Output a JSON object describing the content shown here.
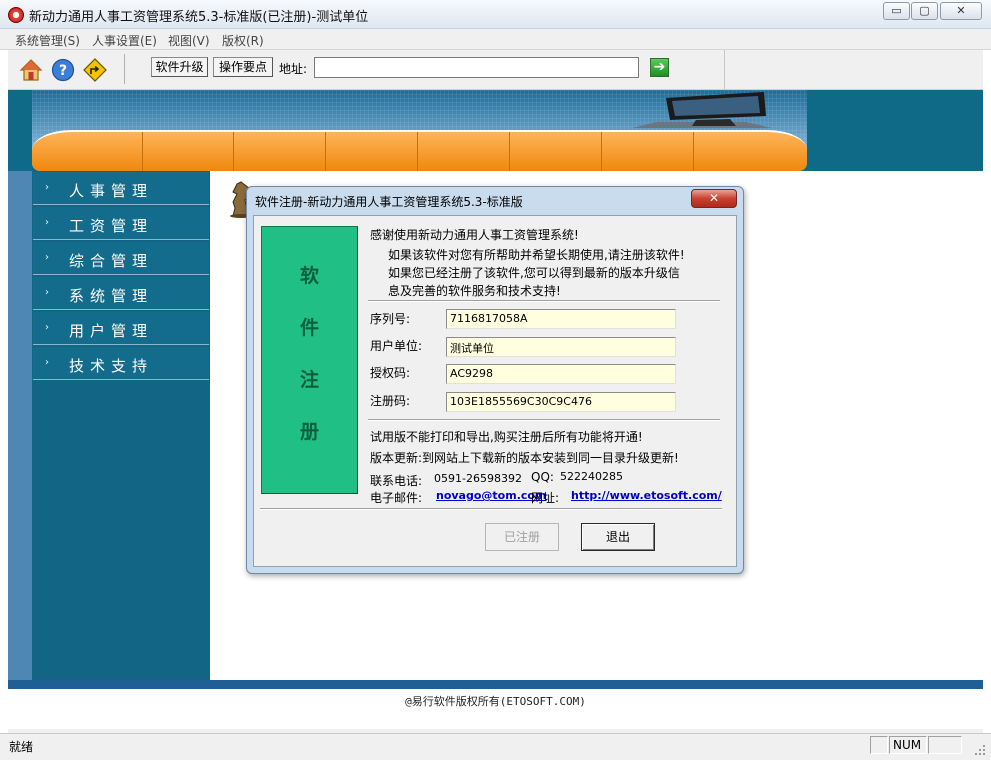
{
  "window": {
    "title": "新动力通用人事工资管理系统5.3-标准版(已注册)-测试单位",
    "minimize_glyph": "▭",
    "maximize_glyph": "▢",
    "close_glyph": "✕"
  },
  "menu": [
    "系统管理(S)",
    "人事设置(E)",
    "视图(V)",
    "版权(R)"
  ],
  "toolbar": {
    "upgrade_label": "软件升级",
    "tips_label": "操作要点",
    "address_label": "地址:",
    "address_value": "",
    "go_glyph": "➔"
  },
  "sidebar": {
    "items": [
      "人事管理",
      "工资管理",
      "综合管理",
      "系统管理",
      "用户管理",
      "技术支持"
    ]
  },
  "dialog": {
    "title": "软件注册-新动力通用人事工资管理系统5.3-标准版",
    "close_glyph": "✕",
    "panel_chars": [
      "软",
      "件",
      "注",
      "册"
    ],
    "thanks": "感谢使用新动力通用人事工资管理系统!",
    "line1": "如果该软件对您有所帮助并希望长期使用,请注册该软件!",
    "line2": "如果您已经注册了该软件,您可以得到最新的版本升级信",
    "line3": "息及完善的软件服务和技术支持!",
    "fields": {
      "serial_label": "序列号:",
      "serial_value": "7116817058A",
      "company_label": "用户单位:",
      "company_value": "测试单位",
      "auth_label": "授权码:",
      "auth_value": "AC9298",
      "reg_label": "注册码:",
      "reg_value": "103E1855569C30C9C476"
    },
    "trial_note": "试用版不能打印和导出,购买注册后所有功能将开通!",
    "update_note": "版本更新:到网站上下载新的版本安装到同一目录升级更新!",
    "phone_label": "联系电话:",
    "phone_value": "0591-26598392",
    "qq_label": "QQ:",
    "qq_value": "522240285",
    "email_label": "电子邮件:",
    "email_value": "novago@tom.com",
    "site_label": "网址:",
    "site_value": "http://www.etosoft.com/",
    "registered_button": "已注册",
    "exit_button": "退出"
  },
  "footer": {
    "copyright": "@易行软件版权所有(ETOSOFT.COM)"
  },
  "status": {
    "text": "就绪",
    "num": "NUM"
  },
  "colors": {
    "sidebar": "#126585",
    "banner_orange": "#f0880c",
    "dialog_panel": "#1fbf86",
    "field_bg": "#ffffe0",
    "link": "#0000cc"
  }
}
